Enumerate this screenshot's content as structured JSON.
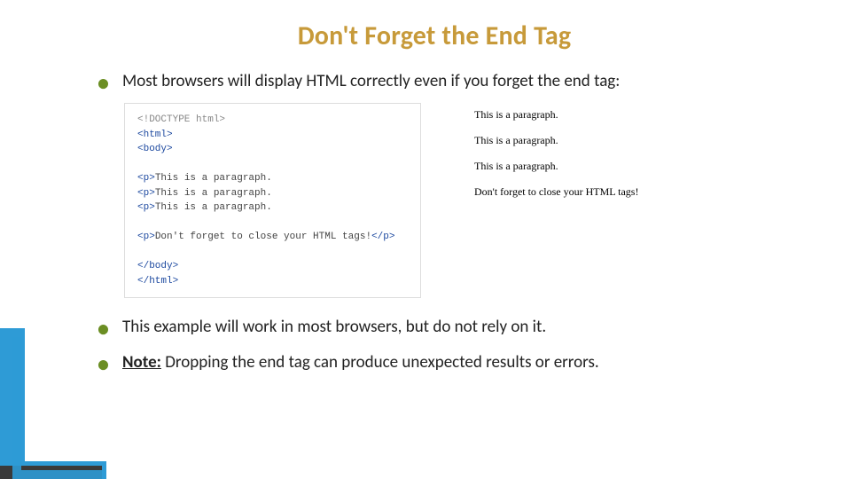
{
  "title": "Don't Forget the End Tag",
  "bullets": {
    "b1": "Most browsers will display HTML correctly even if you forget the end tag:",
    "b2": "This example will work in most browsers, but do not rely on it.",
    "b3_note": "Note:",
    "b3_rest": " Dropping the end tag can produce unexpected results or errors."
  },
  "code": {
    "l1": "<!DOCTYPE html>",
    "l2": "<html>",
    "l3": "<body>",
    "blank1": "",
    "l4a": "<p>",
    "l4b": "This is a paragraph.",
    "l5a": "<p>",
    "l5b": "This is a paragraph.",
    "l6a": "<p>",
    "l6b": "This is a paragraph.",
    "blank2": "",
    "l7a": "<p>",
    "l7b": "Don't forget to close your HTML tags!",
    "l7c": "</p>",
    "blank3": "",
    "l8": "</body>",
    "l9": "</html>"
  },
  "render": {
    "p1": "This is a paragraph.",
    "p2": "This is a paragraph.",
    "p3": "This is a paragraph.",
    "p4": "Don't forget to close your HTML tags!"
  },
  "accent": {
    "stripe_blue": "#2e9bd6",
    "stripe_dark": "#3a3a3a"
  }
}
